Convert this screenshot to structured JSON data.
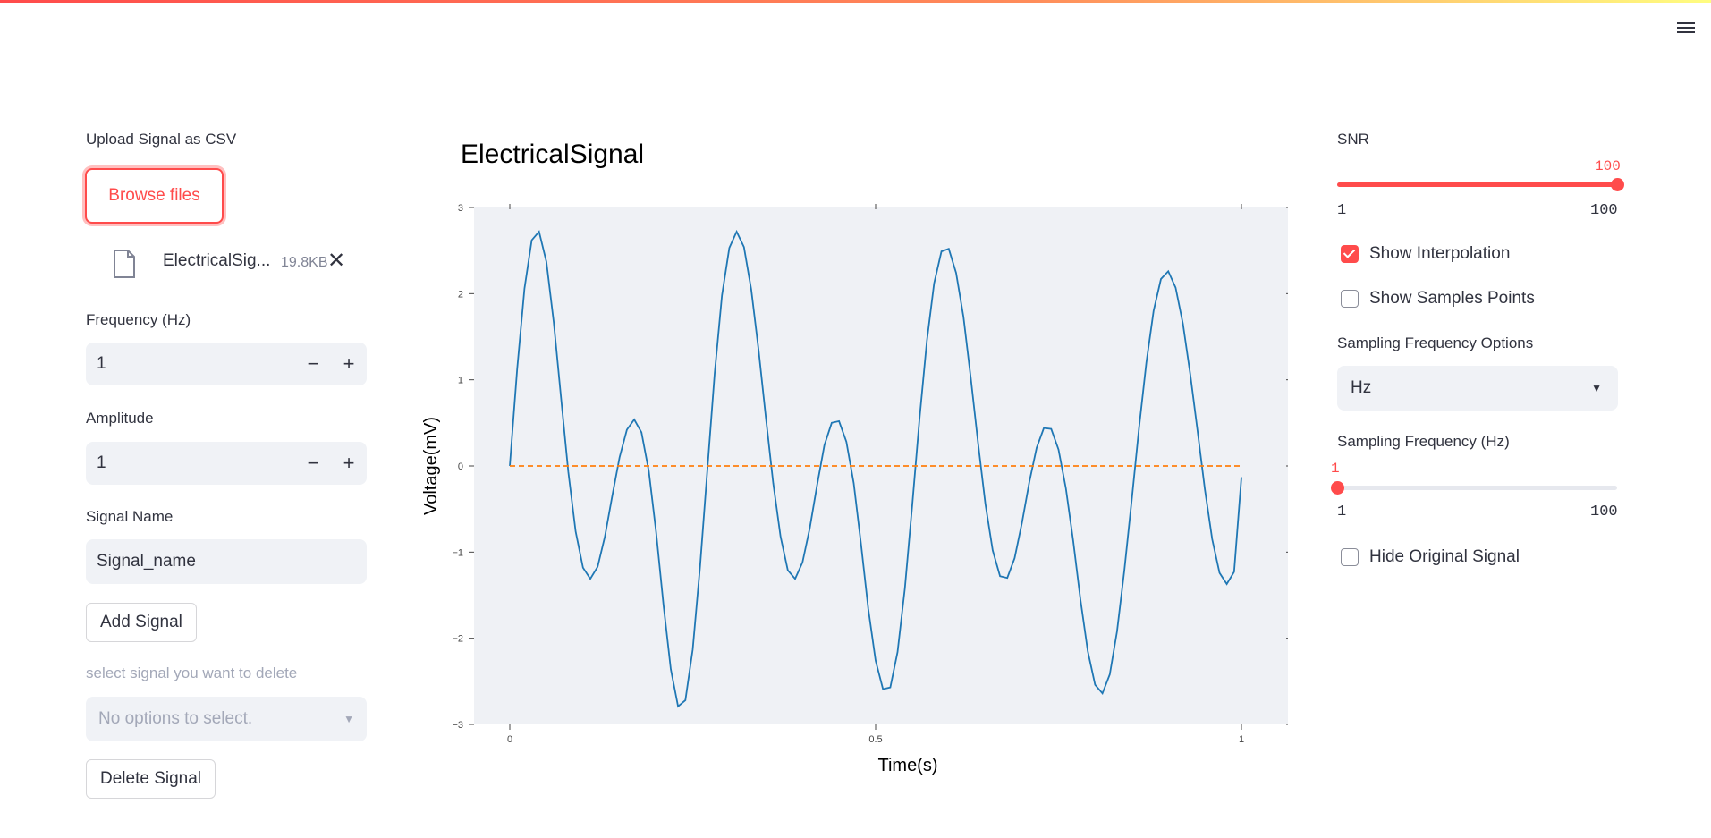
{
  "header": {
    "menu_icon": "hamburger-menu-icon"
  },
  "sidebar_left": {
    "upload_label": "Upload Signal as CSV",
    "browse_label": "Browse files",
    "file": {
      "icon": "file-icon",
      "name": "ElectricalSig...",
      "size": "19.8KB",
      "remove": "✕"
    },
    "frequency": {
      "label": "Frequency (Hz)",
      "value": "1",
      "minus": "−",
      "plus": "+"
    },
    "amplitude": {
      "label": "Amplitude",
      "value": "1",
      "minus": "−",
      "plus": "+"
    },
    "signal_name": {
      "label": "Signal Name",
      "value": "Signal_name"
    },
    "add_button": "Add Signal",
    "delete_select": {
      "label": "select signal you want to delete",
      "placeholder": "No options to select.",
      "caret": "▼"
    },
    "delete_button": "Delete Signal"
  },
  "main": {
    "title": "ElectricalSignal"
  },
  "sidebar_right": {
    "snr": {
      "label": "SNR",
      "value": 100,
      "min": "1",
      "max": "100",
      "display": "100"
    },
    "show_interpolation": {
      "label": "Show Interpolation",
      "checked": true
    },
    "show_samples": {
      "label": "Show Samples Points",
      "checked": false
    },
    "sampling_options": {
      "label": "Sampling Frequency Options",
      "selected": "Hz",
      "caret": "▼"
    },
    "sampling_freq": {
      "label": "Sampling Frequency (Hz)",
      "value": 1,
      "min": "1",
      "max": "100",
      "display": "1"
    },
    "hide_original": {
      "label": "Hide Original Signal",
      "checked": false
    }
  },
  "chart_data": {
    "type": "line",
    "xlabel": "Time(s)",
    "ylabel": "Voltage(mV)",
    "xlim": [
      0,
      1
    ],
    "ylim": [
      -3,
      3
    ],
    "x_ticks": [
      "0",
      "0.5",
      "1"
    ],
    "x_tick_values": [
      0,
      0.5,
      1
    ],
    "y_ticks": [
      "3",
      "2",
      "1",
      "0",
      "−1",
      "−2",
      "−3"
    ],
    "y_tick_values": [
      3,
      2,
      1,
      0,
      -1,
      -2,
      -3
    ],
    "series": [
      {
        "color": "#1f77b4",
        "style": "solid",
        "x": [
          0,
          0.01,
          0.02,
          0.03,
          0.04,
          0.05,
          0.06,
          0.07,
          0.08,
          0.09,
          0.1,
          0.11,
          0.12,
          0.13,
          0.14,
          0.15,
          0.16,
          0.17,
          0.18,
          0.19,
          0.2,
          0.21,
          0.22,
          0.23,
          0.24,
          0.25,
          0.26,
          0.27,
          0.28,
          0.29,
          0.3,
          0.31,
          0.32,
          0.33,
          0.34,
          0.35,
          0.36,
          0.37,
          0.38,
          0.39,
          0.4,
          0.41,
          0.42,
          0.43,
          0.44,
          0.45,
          0.46,
          0.47,
          0.48,
          0.49,
          0.5,
          0.51,
          0.52,
          0.53,
          0.54,
          0.55,
          0.56,
          0.57,
          0.58,
          0.59,
          0.6,
          0.61,
          0.62,
          0.63,
          0.64,
          0.65,
          0.66,
          0.67,
          0.68,
          0.69,
          0.7,
          0.71,
          0.72,
          0.73,
          0.74,
          0.75,
          0.76,
          0.77,
          0.78,
          0.79,
          0.8,
          0.81,
          0.82,
          0.83,
          0.84,
          0.85,
          0.86,
          0.87,
          0.88,
          0.89,
          0.9,
          0.91,
          0.92,
          0.93,
          0.94,
          0.95,
          0.96,
          0.97,
          0.98,
          0.99,
          1
        ],
        "y": [
          0,
          1.12,
          2.06,
          2.62,
          2.72,
          2.37,
          1.67,
          0.79,
          -0.07,
          -0.76,
          -1.18,
          -1.31,
          -1.17,
          -0.82,
          -0.35,
          0.1,
          0.42,
          0.54,
          0.39,
          -0.06,
          -0.77,
          -1.61,
          -2.36,
          -2.79,
          -2.72,
          -2.13,
          -1.17,
          -0.04,
          1.07,
          1.98,
          2.53,
          2.72,
          2.54,
          2.05,
          1.35,
          0.56,
          -0.2,
          -0.82,
          -1.21,
          -1.31,
          -1.12,
          -0.72,
          -0.22,
          0.24,
          0.5,
          0.52,
          0.28,
          -0.2,
          -0.9,
          -1.66,
          -2.26,
          -2.59,
          -2.57,
          -2.16,
          -1.42,
          -0.46,
          0.55,
          1.45,
          2.12,
          2.49,
          2.52,
          2.24,
          1.73,
          1.03,
          0.27,
          -0.44,
          -0.98,
          -1.28,
          -1.3,
          -1.07,
          -0.66,
          -0.19,
          0.21,
          0.44,
          0.43,
          0.19,
          -0.26,
          -0.87,
          -1.55,
          -2.15,
          -2.54,
          -2.64,
          -2.42,
          -1.92,
          -1.21,
          -0.4,
          0.44,
          1.2,
          1.8,
          2.17,
          2.26,
          2.07,
          1.65,
          1.07,
          0.41,
          -0.27,
          -0.85,
          -1.24,
          -1.37,
          -1.23,
          -0.13
        ]
      },
      {
        "color": "#ff7f0e",
        "style": "dashed",
        "x": [
          0,
          1
        ],
        "y": [
          0,
          0
        ]
      }
    ]
  }
}
